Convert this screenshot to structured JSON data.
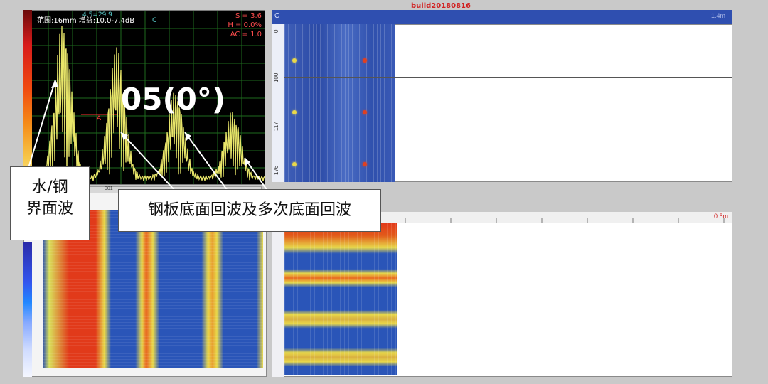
{
  "window": {
    "build_label": "build20180816"
  },
  "ascan": {
    "range_gain_text": "范围:16mm  增益:10.0-7.4dB",
    "cursor_text": "4.5=29.9",
    "cursor_c": "C",
    "readout_s": "S = 3.6",
    "readout_h": "H = 0.0%",
    "readout_ac": "AC = 1.0",
    "gate_label": "A",
    "angle_label": "05(0°)",
    "trace_color": "#e9e66a",
    "grid_color": "#1e6a1e"
  },
  "bscan": {
    "header_letter": "C",
    "header_right": "1.4m",
    "axis_ticks": [
      "0",
      "100",
      "117",
      "176"
    ],
    "defect_color": "#e04020"
  },
  "cscan": {
    "toolbar_text": "001"
  },
  "dscan": {
    "ruler_right": "0.5m"
  },
  "callouts": {
    "interface_line1": "水/钢",
    "interface_line2": "界面波",
    "bottom_echo": "钢板底面回波及多次底面回波"
  }
}
